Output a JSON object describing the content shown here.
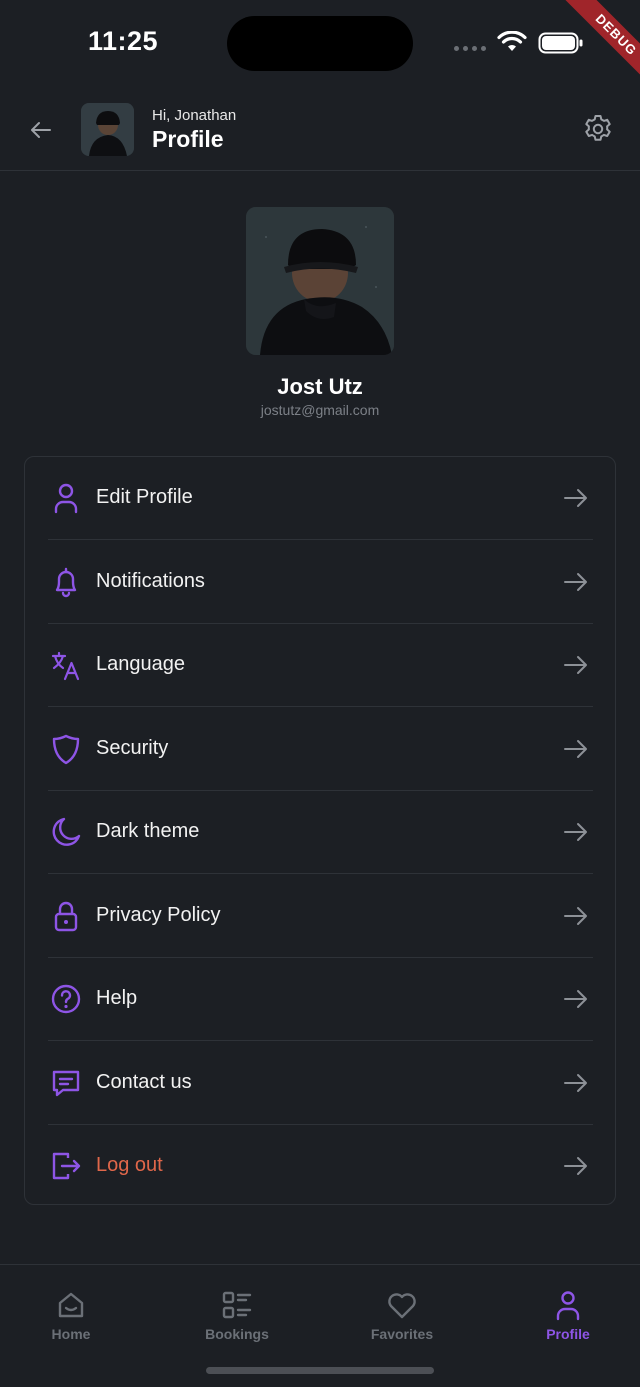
{
  "status_bar": {
    "time": "11:25",
    "debug_banner": "DEBUG"
  },
  "header": {
    "greeting": "Hi, Jonathan",
    "title": "Profile",
    "back_icon": "arrow-left-icon",
    "settings_icon": "gear-icon"
  },
  "profile": {
    "name": "Jost Utz",
    "email": "jostutz@gmail.com"
  },
  "menu": {
    "items": [
      {
        "label": "Edit Profile",
        "icon": "user-icon"
      },
      {
        "label": "Notifications",
        "icon": "bell-icon"
      },
      {
        "label": "Language",
        "icon": "translate-icon"
      },
      {
        "label": "Security",
        "icon": "shield-icon"
      },
      {
        "label": "Dark theme",
        "icon": "moon-icon"
      },
      {
        "label": "Privacy Policy",
        "icon": "lock-icon"
      },
      {
        "label": "Help",
        "icon": "help-circle-icon"
      },
      {
        "label": "Contact us",
        "icon": "message-icon"
      },
      {
        "label": "Log out",
        "icon": "logout-icon"
      }
    ]
  },
  "bottom_nav": {
    "items": [
      {
        "label": "Home",
        "icon": "home-icon",
        "active": false
      },
      {
        "label": "Bookings",
        "icon": "list-icon",
        "active": false
      },
      {
        "label": "Favorites",
        "icon": "heart-icon",
        "active": false
      },
      {
        "label": "Profile",
        "icon": "user-icon",
        "active": true
      }
    ]
  },
  "colors": {
    "background": "#1c1f24",
    "accent": "#8e55e6",
    "danger": "#e0674a",
    "divider": "#2e3238",
    "muted_text": "#7c8087"
  }
}
